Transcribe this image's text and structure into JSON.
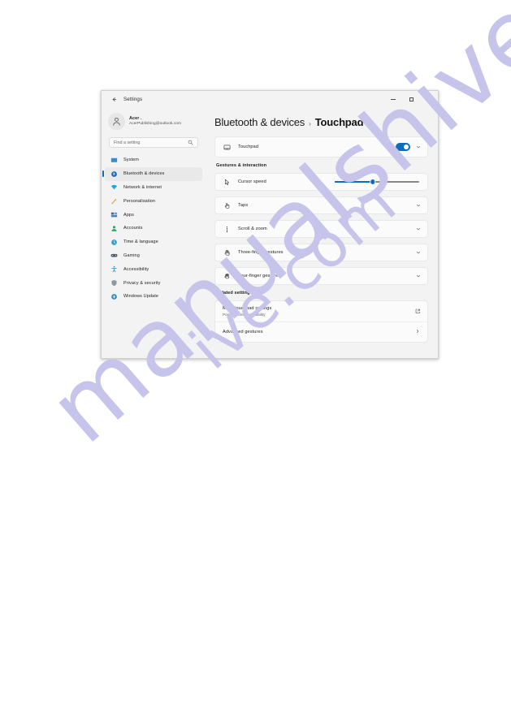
{
  "window": {
    "title": "Settings",
    "back_icon": "back-arrow-icon",
    "controls": {
      "minimize": "minimize-icon",
      "maximize": "maximize-icon",
      "close": "close-icon"
    }
  },
  "account": {
    "name": "Acer .",
    "email": "AcerPublishing@outlook.com",
    "avatar_icon": "person-avatar-icon"
  },
  "search": {
    "placeholder": "Find a setting",
    "value": "",
    "icon": "search-icon"
  },
  "sidebar": {
    "items": [
      {
        "label": "System",
        "icon": "system-icon",
        "active": false
      },
      {
        "label": "Bluetooth & devices",
        "icon": "bluetooth-devices-icon",
        "active": true
      },
      {
        "label": "Network & internet",
        "icon": "network-internet-icon",
        "active": false
      },
      {
        "label": "Personalisation",
        "icon": "personalisation-icon",
        "active": false
      },
      {
        "label": "Apps",
        "icon": "apps-icon",
        "active": false
      },
      {
        "label": "Accounts",
        "icon": "accounts-icon",
        "active": false
      },
      {
        "label": "Time & language",
        "icon": "time-language-icon",
        "active": false
      },
      {
        "label": "Gaming",
        "icon": "gaming-icon",
        "active": false
      },
      {
        "label": "Accessibility",
        "icon": "accessibility-icon",
        "active": false
      },
      {
        "label": "Privacy & security",
        "icon": "privacy-security-icon",
        "active": false
      },
      {
        "label": "Windows Update",
        "icon": "windows-update-icon",
        "active": false
      }
    ]
  },
  "breadcrumb": {
    "parent": "Bluetooth & devices",
    "separator": "›",
    "current": "Touchpad"
  },
  "touchpad_card": {
    "label": "Touchpad",
    "icon": "touchpad-icon",
    "toggle_state_label": "On",
    "toggle_on": true,
    "expand_icon": "chevron-down-icon"
  },
  "gestures_section": {
    "title": "Gestures & interaction",
    "cursor_speed": {
      "label": "Cursor speed",
      "icon": "cursor-pointer-icon",
      "value_percent": 45
    },
    "rows": [
      {
        "label": "Taps",
        "icon": "tap-hand-icon",
        "expand_icon": "chevron-down-icon"
      },
      {
        "label": "Scroll & zoom",
        "icon": "scroll-dots-icon",
        "expand_icon": "chevron-down-icon"
      },
      {
        "label": "Three-finger gestures",
        "icon": "three-finger-hand-icon",
        "expand_icon": "chevron-down-icon"
      },
      {
        "label": "Four-finger gestures",
        "icon": "four-finger-hand-icon",
        "expand_icon": "chevron-down-icon"
      }
    ]
  },
  "related_settings": {
    "title": "Related settings",
    "rows": [
      {
        "label": "More touchpad settings",
        "sublabel": "Pointer icons and visibility",
        "trailing_icon": "open-external-icon"
      },
      {
        "label": "Advanced gestures",
        "sublabel": "",
        "trailing_icon": "chevron-right-icon"
      }
    ]
  },
  "watermark": {
    "line1": "manualshive",
    "line2": "ive.com",
    "color": "#c6c4ea"
  },
  "colors": {
    "accent": "#0f6cbd",
    "window_bg": "#f3f3f3",
    "card_bg": "#fbfbfb",
    "page_bg": "#ffffff"
  }
}
